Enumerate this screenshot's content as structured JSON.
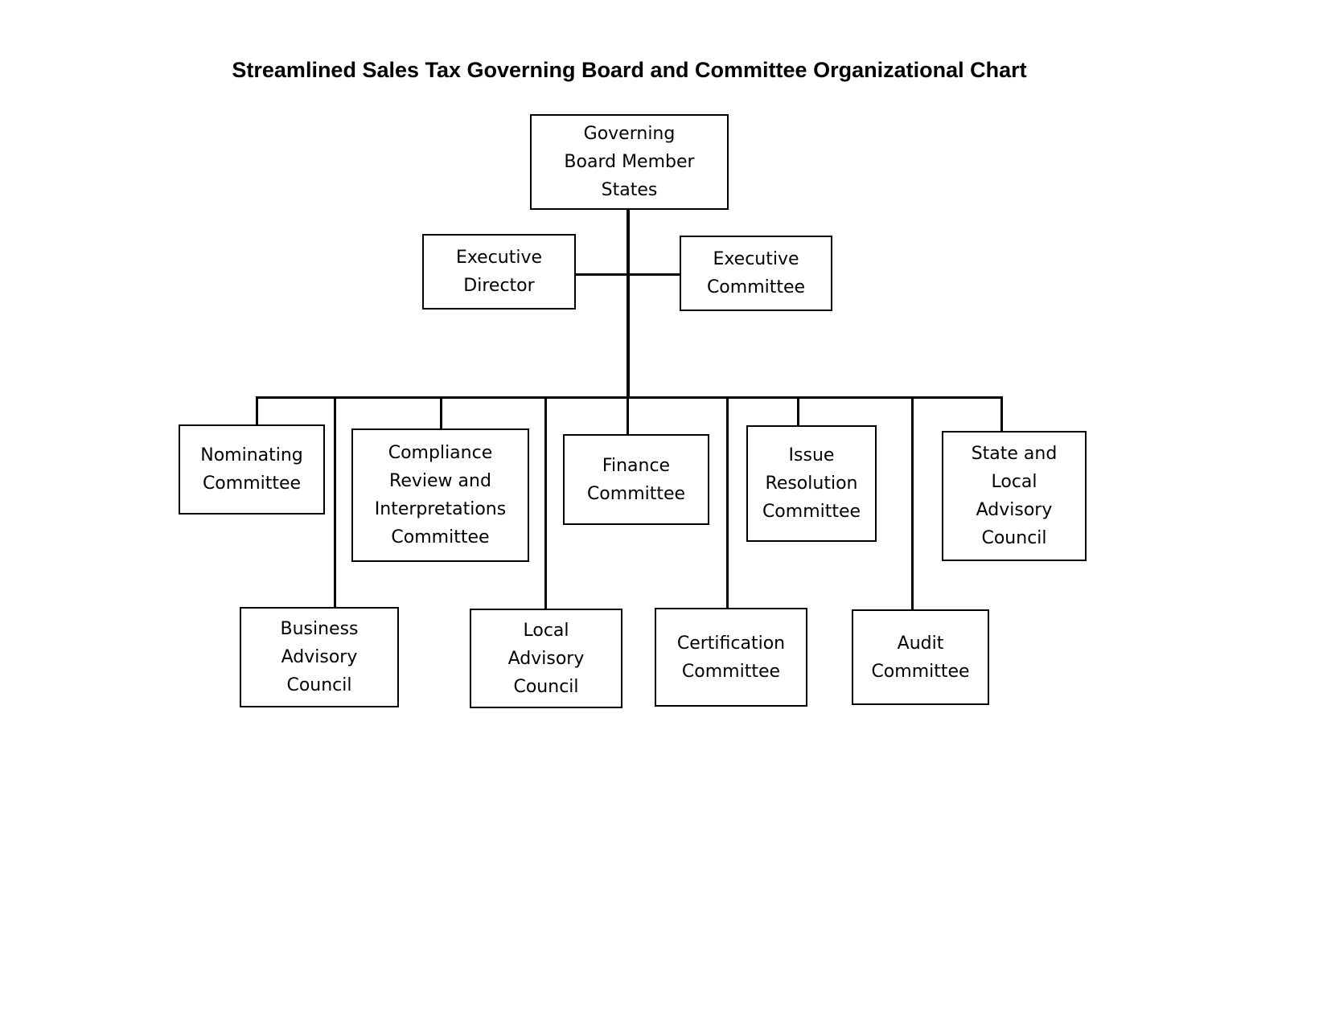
{
  "title": "Streamlined Sales Tax Governing Board and Committee Organizational Chart",
  "nodes": {
    "governing_board": "Governing\nBoard Member\nStates",
    "executive_director": "Executive\nDirector",
    "executive_committee": "Executive\nCommittee",
    "nominating_committee": "Nominating\nCommittee",
    "compliance_review": "Compliance\nReview and\nInterpretations\nCommittee",
    "finance_committee": "Finance\nCommittee",
    "issue_resolution": "Issue\nResolution\nCommittee",
    "state_local_advisory": "State and\nLocal\nAdvisory\nCouncil",
    "business_advisory": "Business\nAdvisory\nCouncil",
    "local_advisory": "Local\nAdvisory\nCouncil",
    "certification_committee": "Certification\nCommittee",
    "audit_committee": "Audit\nCommittee"
  },
  "hierarchy": {
    "root": "governing_board",
    "staff_level": [
      "executive_director",
      "executive_committee"
    ],
    "upper_row": [
      "nominating_committee",
      "compliance_review",
      "finance_committee",
      "issue_resolution",
      "state_local_advisory"
    ],
    "lower_row": [
      "business_advisory",
      "local_advisory",
      "certification_committee",
      "audit_committee"
    ]
  }
}
